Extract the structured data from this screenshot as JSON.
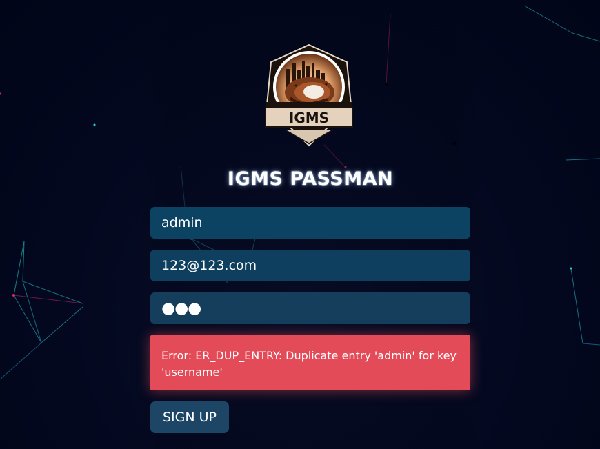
{
  "app": {
    "title": "IGMS PASSMAN",
    "logo_text": "IGMS"
  },
  "form": {
    "username_value": "admin",
    "email_value": "123@123.com",
    "password_masked": "●●●",
    "error_message": "Error: ER_DUP_ENTRY: Duplicate entry 'admin' for key 'username'",
    "signup_label": "SIGN UP"
  },
  "colors": {
    "background": "#020722",
    "input_bg": "#0c4362",
    "error_bg": "#e34b58",
    "button_bg": "#1c4566"
  }
}
